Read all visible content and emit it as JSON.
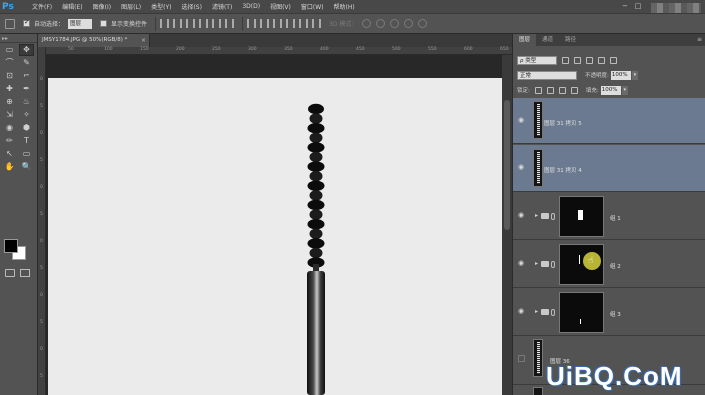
{
  "app": {
    "logo": "Ps"
  },
  "menu": [
    "文件(F)",
    "编辑(E)",
    "图像(I)",
    "图层(L)",
    "类型(Y)",
    "选择(S)",
    "滤镜(T)",
    "3D(D)",
    "视图(V)",
    "窗口(W)",
    "帮助(H)"
  ],
  "window_controls": {
    "minimize": "−",
    "restore": "□",
    "close": "×"
  },
  "options": {
    "auto_select_label": "自动选择：",
    "auto_select_value": "图层",
    "show_transform_label": "显示变换控件",
    "mode_3d_label": "3D 模式："
  },
  "document": {
    "tab_title": "JMSY1784.JPG @ 50%(RGB/8) *",
    "tab_close": "×",
    "ruler_top": [
      "50",
      "100",
      "150",
      "200",
      "250",
      "300",
      "350",
      "400",
      "450",
      "500",
      "550",
      "600",
      "650"
    ],
    "ruler_left": [
      "0",
      "5",
      "0",
      "5",
      "0",
      "5",
      "0",
      "5",
      "0",
      "5",
      "0",
      "5"
    ]
  },
  "toolbox": {
    "grip": "▸▸",
    "tools": [
      "▭",
      "✥",
      "⌒",
      "✎",
      "⊡",
      "⌐",
      "✚",
      "✒",
      "⊕",
      "♨",
      "⇲",
      "✧",
      "◉",
      "⬢",
      "✏",
      "T",
      "↖",
      "▭",
      "✋",
      "🔍"
    ]
  },
  "panel": {
    "tabs": [
      "图层",
      "通道",
      "路径"
    ],
    "menu_icon": "≡",
    "filter_label": "ρ 类型",
    "blend_mode": "正常",
    "opacity_label": "不透明度:",
    "opacity_value": "100%",
    "lock_label": "锁定:",
    "fill_label": "填充:",
    "fill_value": "100%"
  },
  "layers": [
    {
      "name": "图层 31 拷贝 5",
      "kind": "pixel",
      "selected": true,
      "visible": true
    },
    {
      "name": "图层 31 拷贝 4",
      "kind": "pixel",
      "selected": true,
      "visible": true
    },
    {
      "name": "组 1",
      "kind": "group",
      "selected": false,
      "visible": true
    },
    {
      "name": "组 2",
      "kind": "group",
      "selected": false,
      "visible": true
    },
    {
      "name": "组 3",
      "kind": "group",
      "selected": false,
      "visible": true
    },
    {
      "name": "图层 36",
      "kind": "pixel",
      "selected": false,
      "visible": false
    }
  ],
  "watermark": "UiBQ.CoM",
  "colors": {
    "ui_dark": "#323232",
    "ui_mid": "#535353",
    "canvas": "#ebebeb",
    "selected_layer": "#6b7a90",
    "ps_blue": "#31a8ff",
    "cursor_highlight": "#cbc63a"
  }
}
